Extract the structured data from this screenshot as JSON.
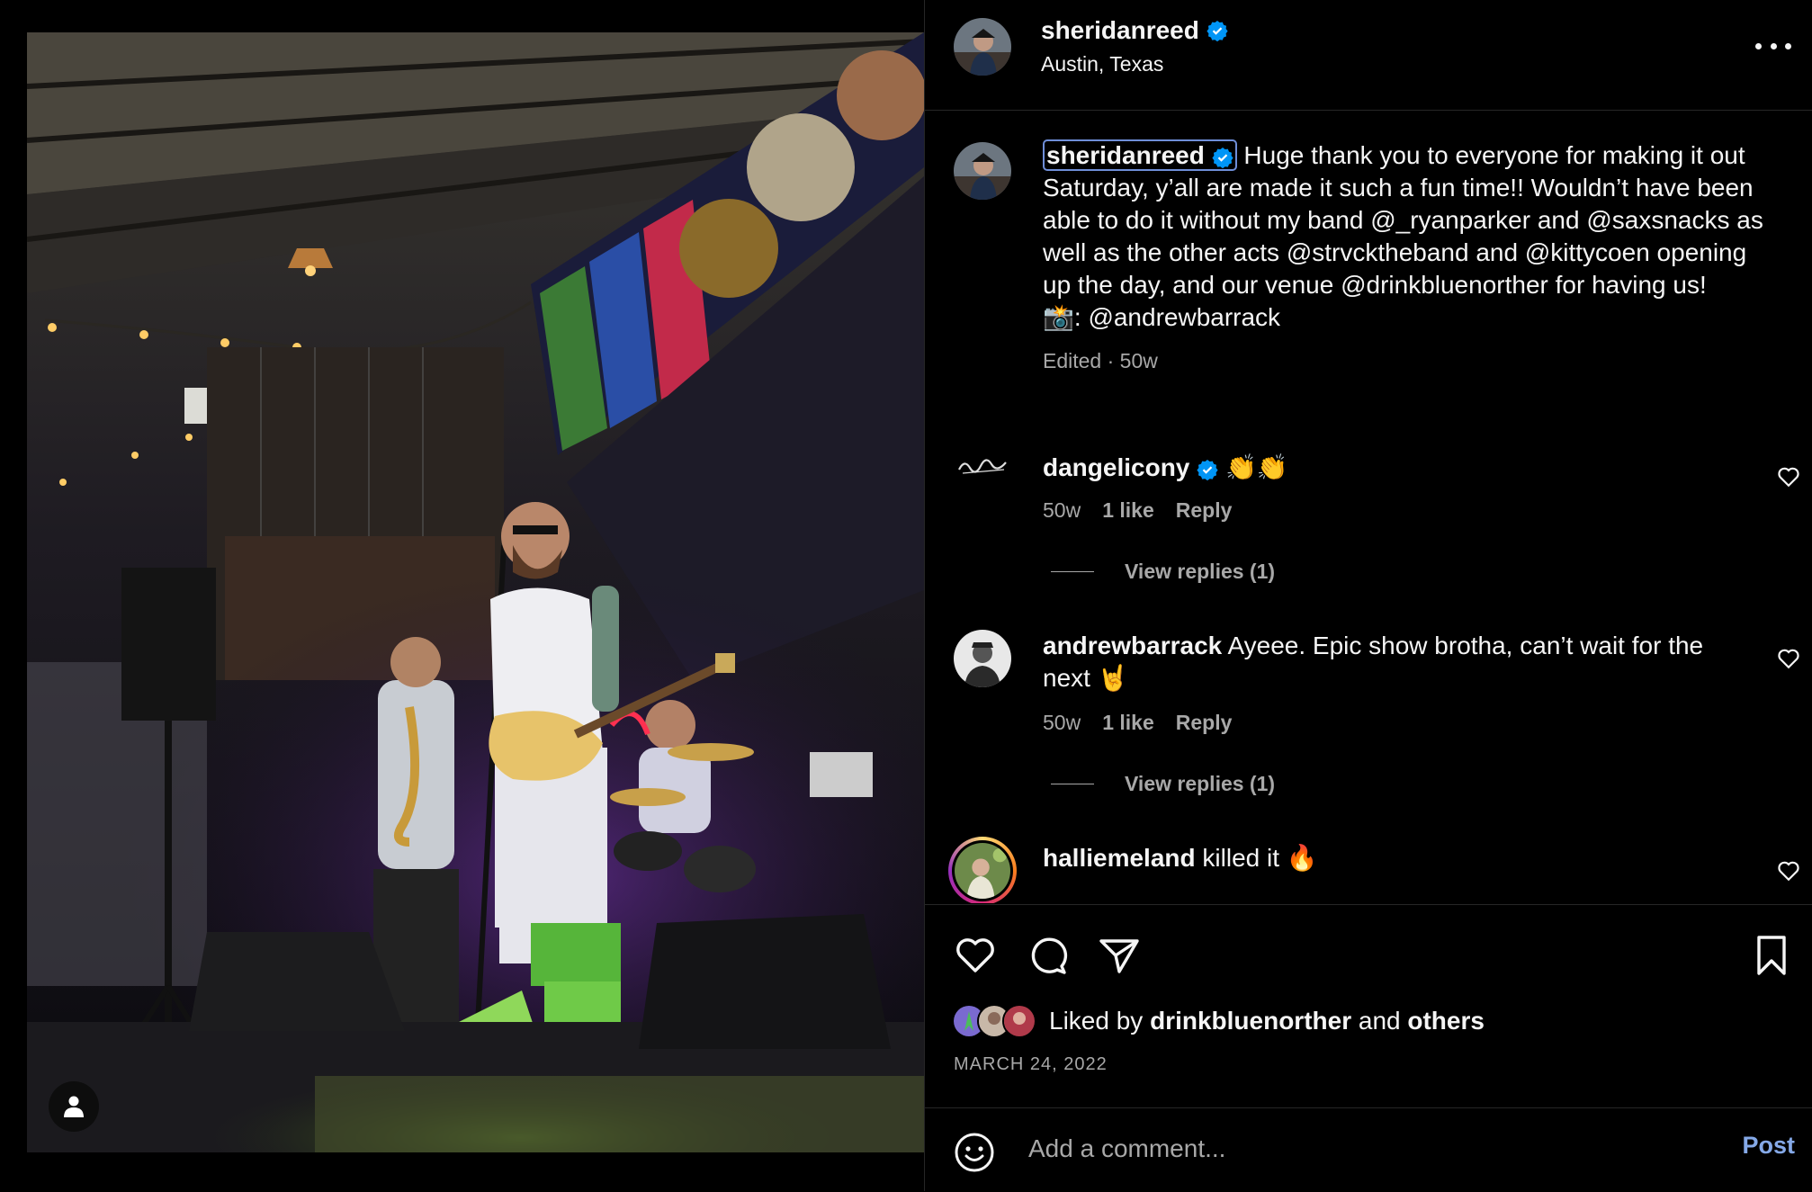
{
  "post": {
    "username": "sheridanreed",
    "location": "Austin, Texas",
    "caption_segments": [
      {
        "text": "Huge thank you to everyone for making it out Saturday, y’all are made it such a fun time!! Wouldn’t have been able to do it without my band ",
        "mention": false
      },
      {
        "text": "@_ryanparker",
        "mention": true
      },
      {
        "text": " and ",
        "mention": false
      },
      {
        "text": "@saxsnacks",
        "mention": true
      },
      {
        "text": " as well as the other acts ",
        "mention": false
      },
      {
        "text": "@strvcktheband",
        "mention": true
      },
      {
        "text": " and ",
        "mention": false
      },
      {
        "text": "@kittycoen",
        "mention": true
      },
      {
        "text": " opening up the day, and our venue ",
        "mention": false
      },
      {
        "text": "@drinkbluenorther",
        "mention": true
      },
      {
        "text": " for having us!",
        "mention": false
      }
    ],
    "photo_credit_emoji": "📸",
    "photo_credit_sep": ": ",
    "photo_credit_mention": "@andrewbarrack",
    "edited": "Edited",
    "dot": "·",
    "age": "50w"
  },
  "comments": [
    {
      "username": "dangelicony",
      "verified": true,
      "text": "👏👏",
      "age": "50w",
      "likes": "1 like",
      "reply": "Reply",
      "view_replies": "View replies (1)"
    },
    {
      "username": "andrewbarrack",
      "verified": false,
      "text": "Ayeee. Epic show brotha, can’t wait for the next 🤘",
      "age": "50w",
      "likes": "1 like",
      "reply": "Reply",
      "view_replies": "View replies (1)"
    },
    {
      "username": "halliemeland",
      "verified": false,
      "text": "killed it 🔥"
    }
  ],
  "likes": {
    "prefix": "Liked by",
    "user": "drinkbluenorther",
    "and": "and",
    "others": "others"
  },
  "date": "MARCH 24, 2022",
  "add_comment": {
    "placeholder": "Add a comment...",
    "post_label": "Post"
  },
  "colors": {
    "background": "#000000",
    "text": "#f5f5f5",
    "secondary": "#a8a8a8",
    "mention": "#e0f1ff",
    "verified": "#0095f6",
    "post_button": "#85a9e8",
    "divider": "#262626"
  },
  "icons": [
    "verified-badge-icon",
    "more-options-icon",
    "heart-icon",
    "comment-icon",
    "share-icon",
    "bookmark-icon",
    "emoji-icon",
    "user-tag-icon"
  ]
}
